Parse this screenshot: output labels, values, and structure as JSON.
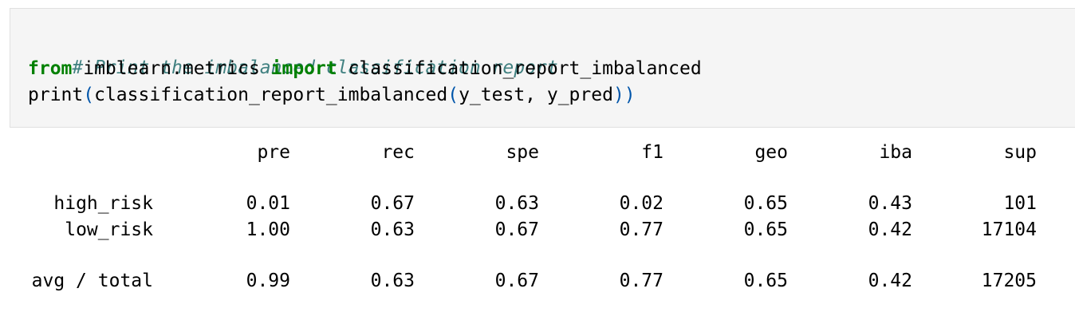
{
  "code_cell": {
    "line1_comment": "# Print the imbalanced classification report",
    "line2": {
      "kw_from": "from",
      "module": " imblearn.metrics ",
      "kw_import": "import",
      "name": " classification_report_imbalanced"
    },
    "line3": {
      "print": "print",
      "open1": "(",
      "func": "classification_report_imbalanced",
      "open2": "(",
      "args": "y_test, y_pred",
      "close": "))"
    }
  },
  "report": {
    "headers": [
      "pre",
      "rec",
      "spe",
      "f1",
      "geo",
      "iba",
      "sup"
    ],
    "rows": [
      {
        "label": "high_risk",
        "values": [
          "0.01",
          "0.67",
          "0.63",
          "0.02",
          "0.65",
          "0.43",
          "101"
        ]
      },
      {
        "label": "low_risk",
        "values": [
          "1.00",
          "0.63",
          "0.67",
          "0.77",
          "0.65",
          "0.42",
          "17104"
        ]
      }
    ],
    "total": {
      "label": "avg / total",
      "values": [
        "0.99",
        "0.63",
        "0.67",
        "0.77",
        "0.65",
        "0.42",
        "17205"
      ]
    }
  }
}
